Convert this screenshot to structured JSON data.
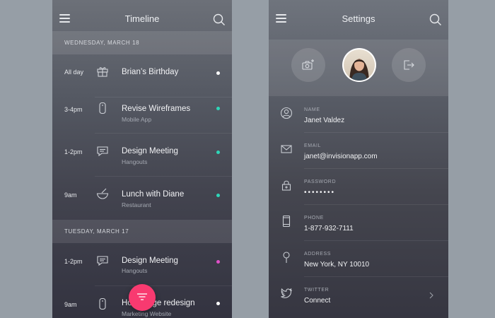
{
  "timeline": {
    "title": "Timeline",
    "days": [
      {
        "label": "WEDNESDAY, MARCH 18",
        "events": [
          {
            "time": "All day",
            "icon": "gift-icon",
            "title": "Brian’s Birthday",
            "subtitle": "",
            "dot_color": "#ffffff"
          },
          {
            "time": "3-4pm",
            "icon": "mobile-icon",
            "title": "Revise Wireframes",
            "subtitle": "Mobile App",
            "dot_color": "#2ed6b8"
          },
          {
            "time": "1-2pm",
            "icon": "chat-icon",
            "title": "Design Meeting",
            "subtitle": "Hangouts",
            "dot_color": "#2ed6b8"
          },
          {
            "time": "9am",
            "icon": "bowl-icon",
            "title": "Lunch with Diane",
            "subtitle": "Restaurant",
            "dot_color": "#2ed6b8"
          }
        ]
      },
      {
        "label": "TUESDAY, MARCH 17",
        "events": [
          {
            "time": "1-2pm",
            "icon": "chat-icon",
            "title": "Design Meeting",
            "subtitle": "Hangouts",
            "dot_color": "#e050c8"
          },
          {
            "time": "9am",
            "icon": "mobile-icon",
            "title": "Homepage redesign",
            "subtitle": "Marketing Website",
            "dot_color": "#ffffff"
          }
        ]
      }
    ],
    "fab_icon": "filter-icon",
    "fab_color": "#f83a70"
  },
  "settings": {
    "title": "Settings",
    "avatar_buttons": {
      "left_icon": "camera-add-icon",
      "right_icon": "logout-icon"
    },
    "fields": [
      {
        "label": "NAME",
        "value": "Janet Valdez",
        "icon": "user-icon"
      },
      {
        "label": "EMAIL",
        "value": "janet@invisionapp.com",
        "icon": "mail-icon"
      },
      {
        "label": "PASSWORD",
        "value": "••••••••",
        "icon": "lock-icon"
      },
      {
        "label": "PHONE",
        "value": "1-877-932-7111",
        "icon": "phone-icon"
      },
      {
        "label": "ADDRESS",
        "value": "New York, NY 10010",
        "icon": "pin-icon"
      },
      {
        "label": "TWITTER",
        "value": "Connect",
        "icon": "twitter-icon"
      }
    ]
  }
}
